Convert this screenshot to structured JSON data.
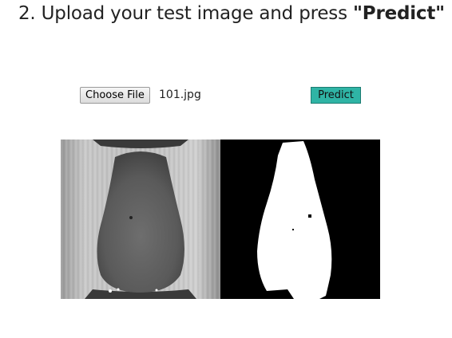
{
  "step": {
    "prefix": "2. Upload your test image and press ",
    "quote_open": "\"",
    "action": "Predict",
    "quote_close": "\""
  },
  "upload": {
    "choose_label": "Choose File",
    "file_name": "101.jpg"
  },
  "predict_button": {
    "label": "Predict",
    "color": "#2fb4a5"
  },
  "images": {
    "input_image": "grayscale-test-image",
    "segmentation_mask": "binary-mask-output"
  }
}
